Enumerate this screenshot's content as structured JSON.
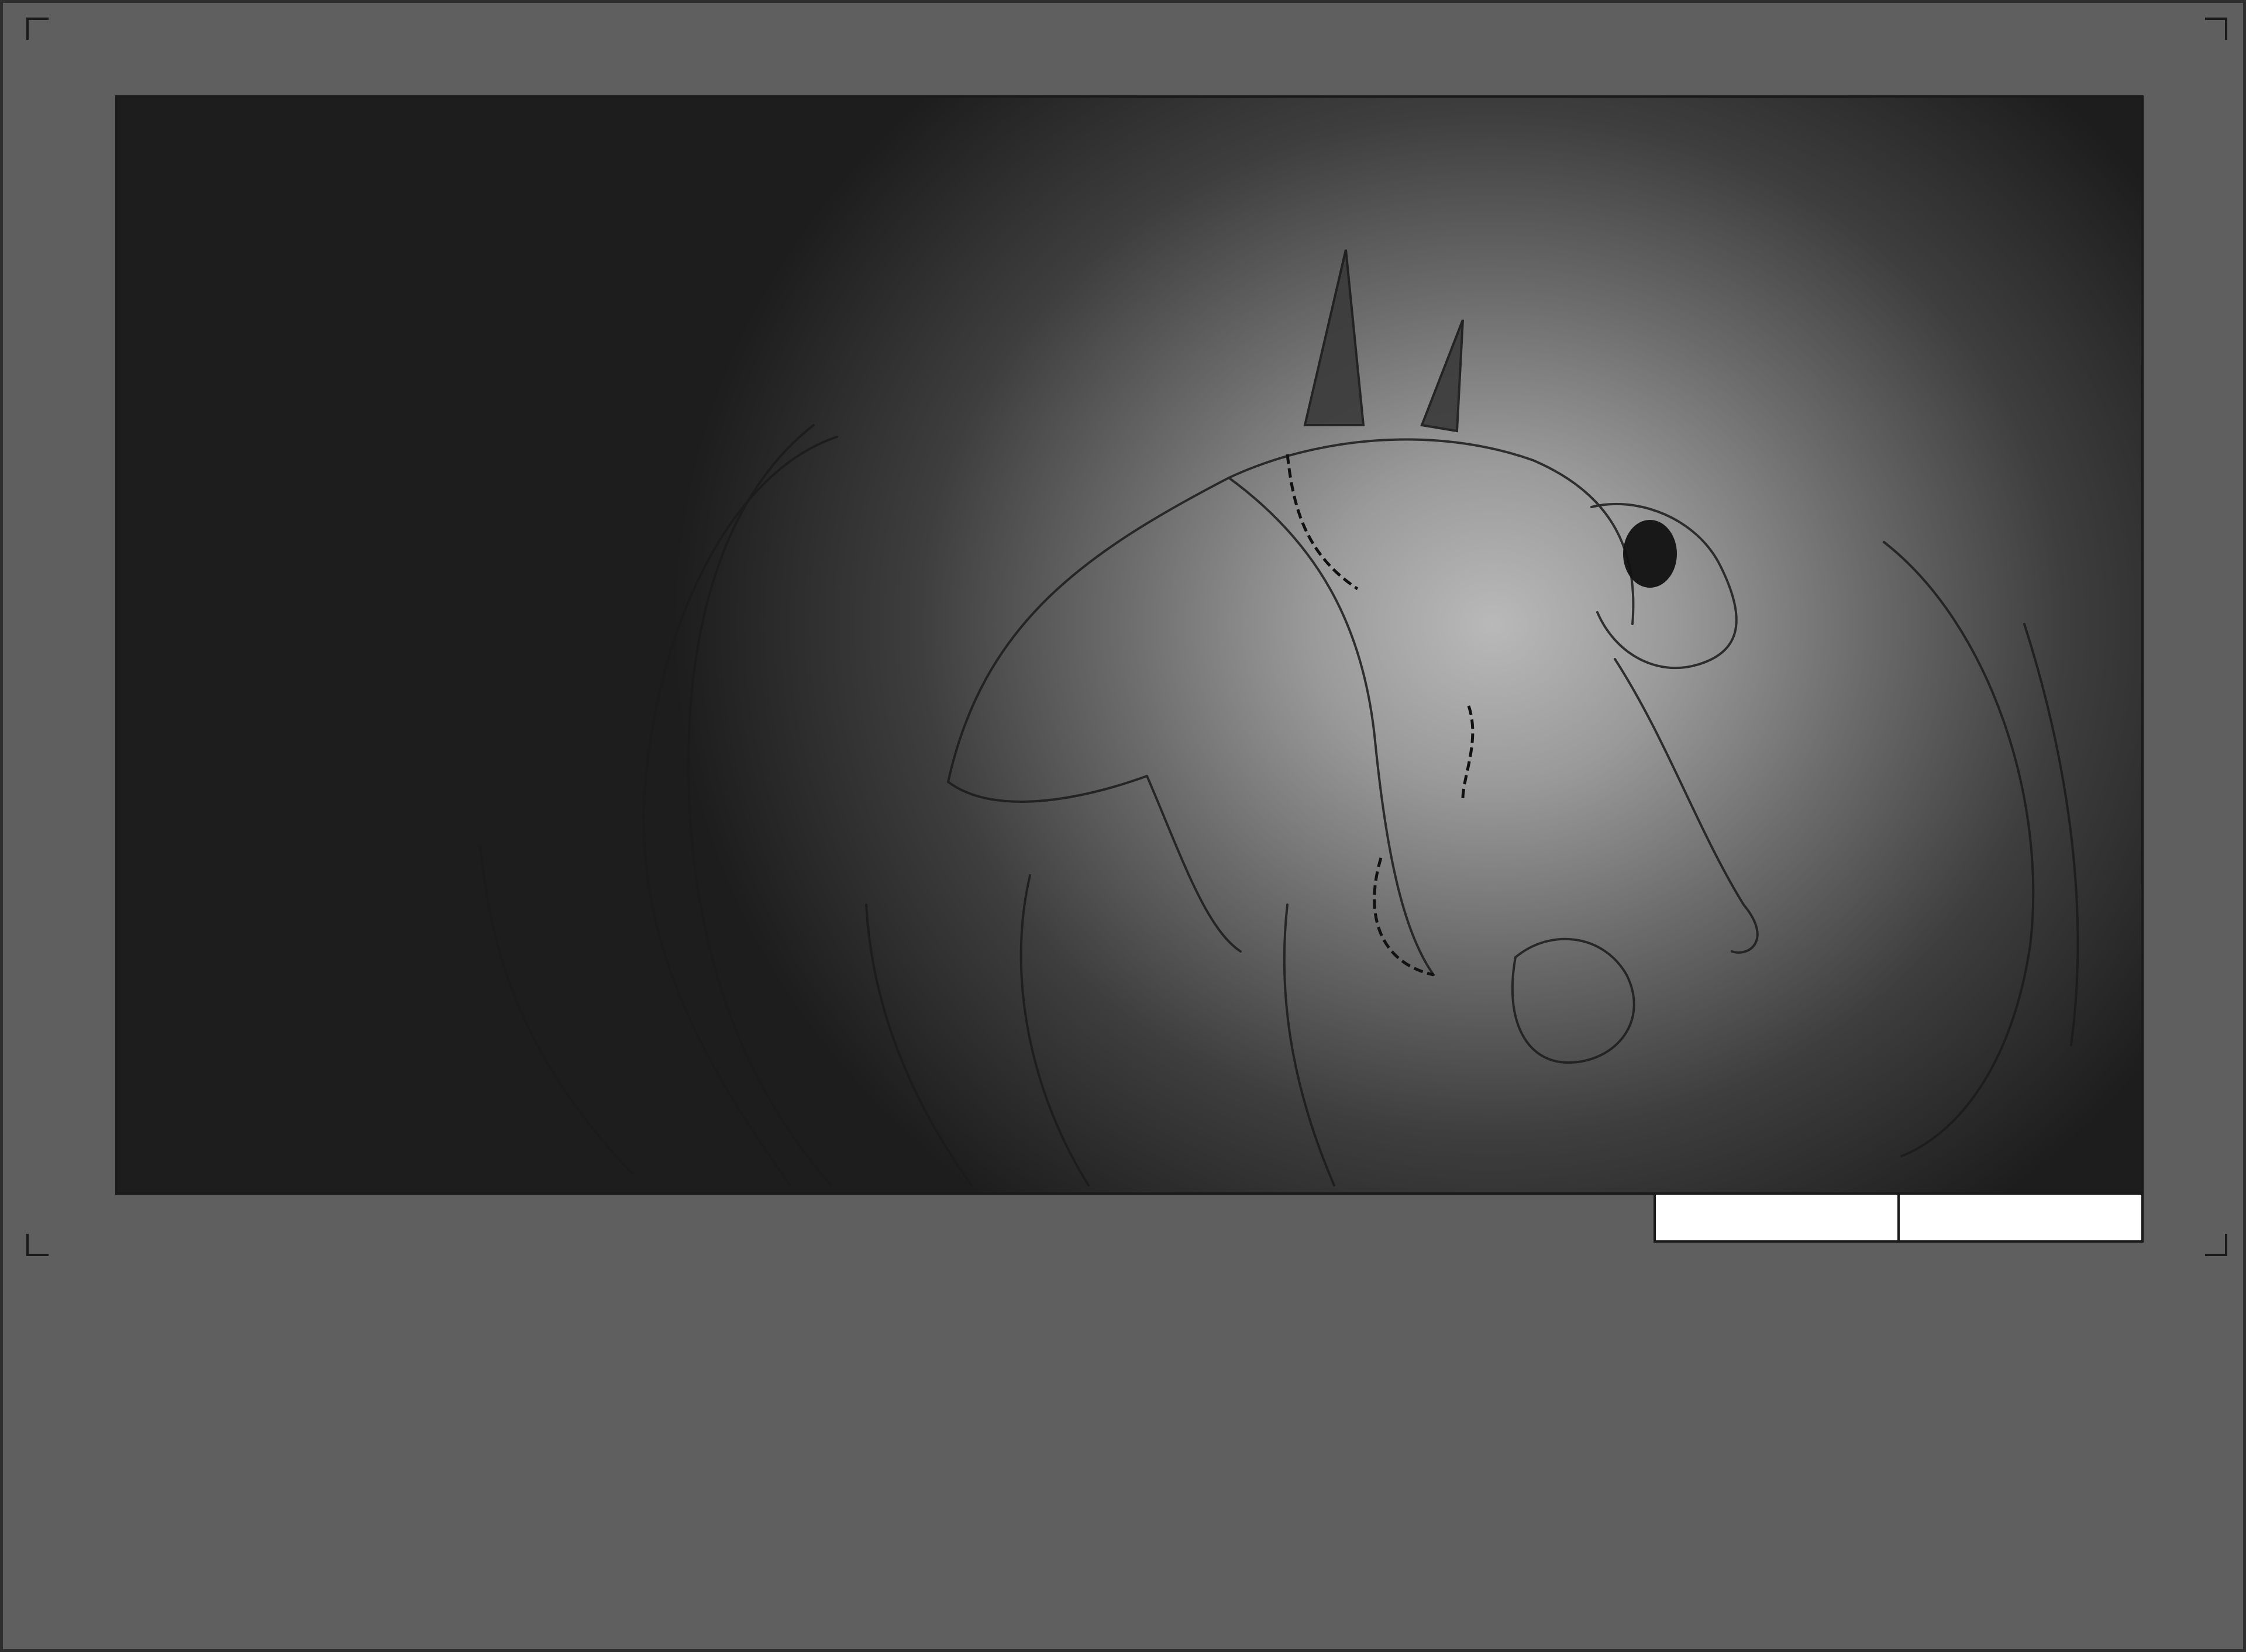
{
  "storyboard": {
    "panel": {
      "illustration": "sketch-chained-horned-beast",
      "colors": {
        "page_background": "#5f5f5f",
        "frame_border": "#1a1a1a",
        "highlight": "#b9b9b9",
        "shadow": "#1d1d1d"
      }
    },
    "caption_boxes": [
      {
        "text": ""
      },
      {
        "text": ""
      }
    ]
  }
}
